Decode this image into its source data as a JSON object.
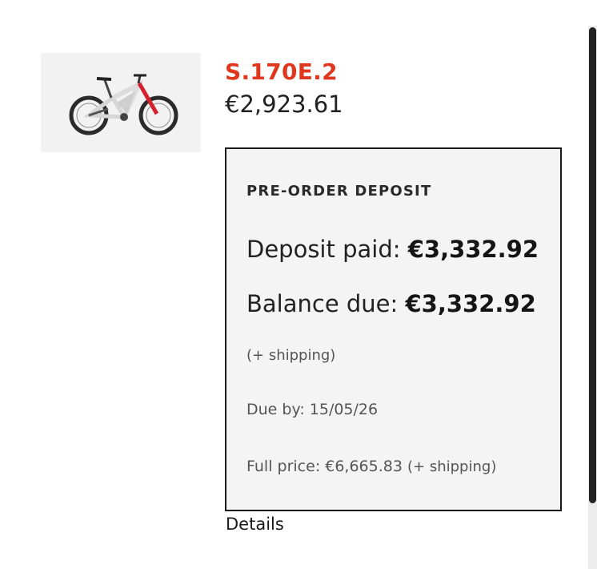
{
  "product": {
    "name": "S.170E.2",
    "price": "€2,923.61",
    "image_icon": "e-mountain-bike-icon",
    "name_color": "#e0371f"
  },
  "deposit": {
    "heading": "PRE-ORDER DEPOSIT",
    "paid_label": "Deposit paid:",
    "paid_value": "€3,332.92",
    "balance_label": "Balance due:",
    "balance_value": "€3,332.92",
    "shipping_note": "(+ shipping)",
    "due_by": "Due by: 15/05/26",
    "full_price_label": "Full price: €6,665.83",
    "full_price_shipping": "(+ shipping)"
  },
  "links": {
    "details_label": "Details"
  }
}
